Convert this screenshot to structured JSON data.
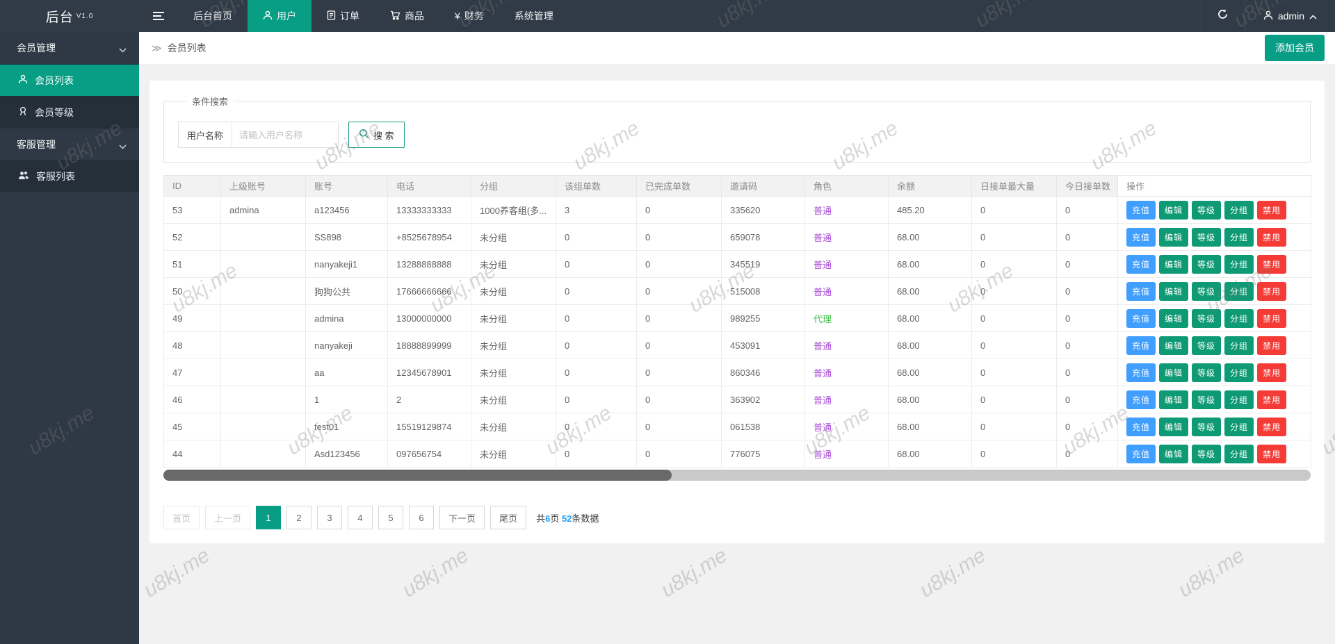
{
  "watermark": {
    "text": "u8kj.me"
  },
  "navbar": {
    "logo": "后台",
    "version": "V1.0",
    "tabs": [
      {
        "label": "后台首页",
        "icon": "",
        "active": false
      },
      {
        "label": "用户",
        "icon": "person-icon",
        "active": true
      },
      {
        "label": "订单",
        "icon": "document-icon",
        "active": false
      },
      {
        "label": "商品",
        "icon": "cart-icon",
        "active": false
      },
      {
        "label": "财务",
        "icon": "yen-icon",
        "active": false
      },
      {
        "label": "系统管理",
        "icon": "",
        "active": false
      }
    ],
    "yen_glyph": "¥",
    "admin_name": "admin"
  },
  "sidebar": {
    "sections": [
      {
        "type": "group",
        "label": "会员管理"
      },
      {
        "type": "item",
        "label": "会员列表",
        "icon": "person-icon",
        "active": true
      },
      {
        "type": "item",
        "label": "会员等级",
        "icon": "level-icon",
        "active": false
      },
      {
        "type": "group",
        "label": "客服管理"
      },
      {
        "type": "item",
        "label": "客服列表",
        "icon": "people-icon",
        "active": false
      }
    ]
  },
  "breadcrumb": {
    "icon": "≫",
    "title": "会员列表",
    "add_button": "添加会员"
  },
  "search": {
    "legend": "条件搜索",
    "field_label": "用户名称",
    "placeholder": "请输入用户名称",
    "button": "搜 索"
  },
  "table": {
    "headers": [
      "ID",
      "上级账号",
      "账号",
      "电话",
      "分组",
      "该组单数",
      "已完成单数",
      "邀请码",
      "角色",
      "余额",
      "日接单最大量",
      "今日接单数",
      "操作"
    ],
    "action_buttons": [
      "充值",
      "编辑",
      "等级",
      "分组",
      "禁用"
    ],
    "rows": [
      {
        "id": "53",
        "parent": "admina",
        "account": "a123456",
        "phone": "13333333333",
        "group": "1000养客组(多...",
        "group_orders": "3",
        "done_orders": "0",
        "invite": "335620",
        "role": "普通",
        "role_class": "purple",
        "balance": "485.20",
        "daily_max": "0",
        "today_orders": "0"
      },
      {
        "id": "52",
        "parent": "",
        "account": "SS898",
        "phone": "+8525678954",
        "group": "未分组",
        "group_orders": "0",
        "done_orders": "0",
        "invite": "659078",
        "role": "普通",
        "role_class": "purple",
        "balance": "68.00",
        "daily_max": "0",
        "today_orders": "0"
      },
      {
        "id": "51",
        "parent": "",
        "account": "nanyakeji1",
        "phone": "13288888888",
        "group": "未分组",
        "group_orders": "0",
        "done_orders": "0",
        "invite": "345519",
        "role": "普通",
        "role_class": "purple",
        "balance": "68.00",
        "daily_max": "0",
        "today_orders": "0"
      },
      {
        "id": "50",
        "parent": "",
        "account": "狗狗公共",
        "phone": "17666666666",
        "group": "未分组",
        "group_orders": "0",
        "done_orders": "0",
        "invite": "515008",
        "role": "普通",
        "role_class": "purple",
        "balance": "68.00",
        "daily_max": "0",
        "today_orders": "0"
      },
      {
        "id": "49",
        "parent": "",
        "account": "admina",
        "phone": "13000000000",
        "group": "未分组",
        "group_orders": "0",
        "done_orders": "0",
        "invite": "989255",
        "role": "代理",
        "role_class": "green",
        "balance": "68.00",
        "daily_max": "0",
        "today_orders": "0"
      },
      {
        "id": "48",
        "parent": "",
        "account": "nanyakeji",
        "phone": "18888899999",
        "group": "未分组",
        "group_orders": "0",
        "done_orders": "0",
        "invite": "453091",
        "role": "普通",
        "role_class": "purple",
        "balance": "68.00",
        "daily_max": "0",
        "today_orders": "0"
      },
      {
        "id": "47",
        "parent": "",
        "account": "aa",
        "phone": "12345678901",
        "group": "未分组",
        "group_orders": "0",
        "done_orders": "0",
        "invite": "860346",
        "role": "普通",
        "role_class": "purple",
        "balance": "68.00",
        "daily_max": "0",
        "today_orders": "0"
      },
      {
        "id": "46",
        "parent": "",
        "account": "1",
        "phone": "2",
        "group": "未分组",
        "group_orders": "0",
        "done_orders": "0",
        "invite": "363902",
        "role": "普通",
        "role_class": "purple",
        "balance": "68.00",
        "daily_max": "0",
        "today_orders": "0"
      },
      {
        "id": "45",
        "parent": "",
        "account": "test01",
        "phone": "15519129874",
        "group": "未分组",
        "group_orders": "0",
        "done_orders": "0",
        "invite": "061538",
        "role": "普通",
        "role_class": "purple",
        "balance": "68.00",
        "daily_max": "0",
        "today_orders": "0"
      },
      {
        "id": "44",
        "parent": "",
        "account": "Asd123456",
        "phone": "097656754",
        "group": "未分组",
        "group_orders": "0",
        "done_orders": "0",
        "invite": "776075",
        "role": "普通",
        "role_class": "purple",
        "balance": "68.00",
        "daily_max": "0",
        "today_orders": "0"
      }
    ]
  },
  "pagination": {
    "first": "首页",
    "prev": "上一页",
    "pages": [
      "1",
      "2",
      "3",
      "4",
      "5",
      "6"
    ],
    "active_page": "1",
    "next": "下一页",
    "last": "尾页",
    "stats": {
      "prefix": "共",
      "total_pages": "6",
      "mid": "页 ",
      "total_records": "52",
      "suffix": "条数据"
    }
  },
  "colors": {
    "accent_teal": "#089e86",
    "navbar_dark": "#303b47",
    "button_blue": "#409eff",
    "button_green": "#0e9a74",
    "button_red": "#f43b36",
    "role_purple": "#a94ad8",
    "role_green": "#3fbf47",
    "link_blue": "#1e9fff"
  }
}
